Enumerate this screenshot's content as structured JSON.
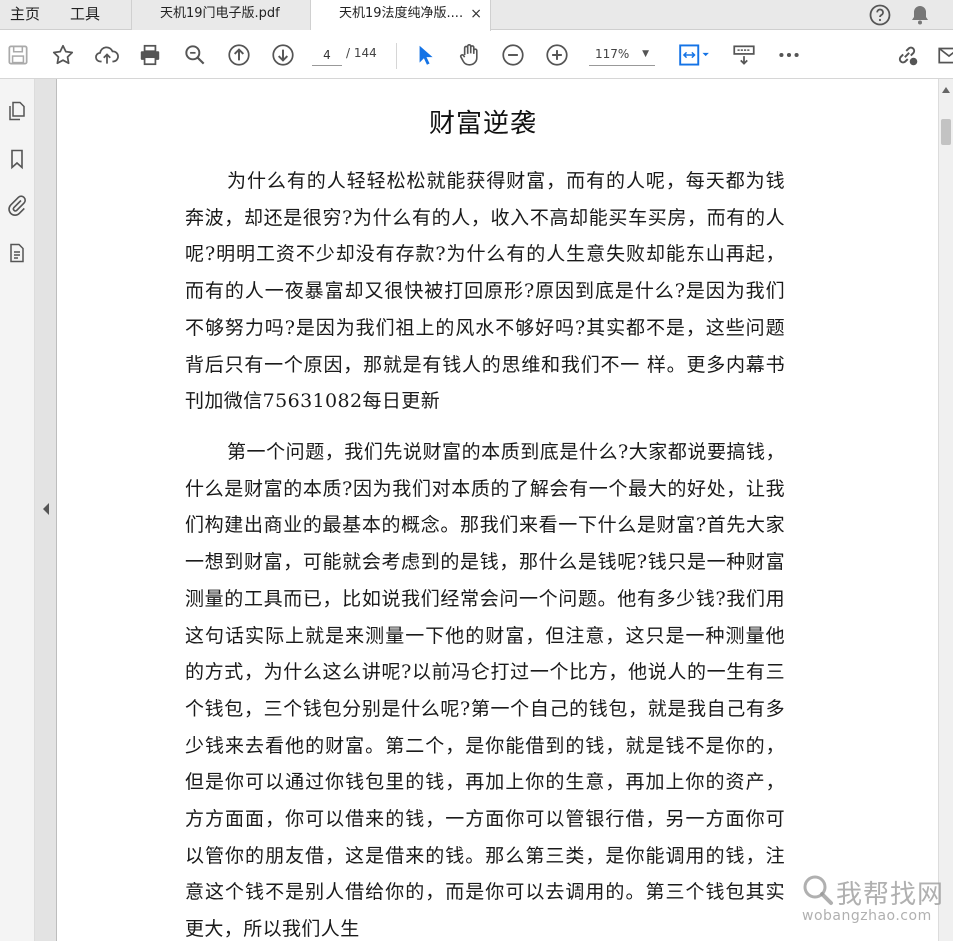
{
  "tabs": {
    "home": "主页",
    "tools": "工具",
    "documents": [
      {
        "label": "天机19门电子版.pdf",
        "active": false
      },
      {
        "label": "天机19法度纯净版....",
        "active": true
      }
    ],
    "close_glyph": "×"
  },
  "toolbar": {
    "page_current": "4",
    "page_total": "/ 144",
    "zoom": "117%",
    "zoom_caret": "▼",
    "icons": [
      "save-icon",
      "bookmark-star-icon",
      "upload-cloud-icon",
      "print-icon",
      "zoom-search-icon",
      "page-up-icon",
      "page-down-icon",
      "select-cursor-icon",
      "hand-pan-icon",
      "zoom-out-icon",
      "zoom-in-icon",
      "fit-page-icon",
      "read-mode-icon",
      "more-icon",
      "share-link-icon",
      "mail-icon"
    ]
  },
  "left_rail": {
    "icons": [
      "page-thumbnails-icon",
      "bookmarks-icon",
      "attachments-icon",
      "document-properties-icon"
    ]
  },
  "document": {
    "title": "财富逆袭",
    "paragraphs": [
      "为什么有的人轻轻松松就能获得财富，而有的人呢，每天都为钱奔波，却还是很穷?为什么有的人，收入不高却能买车买房，而有的人呢?明明工资不少却没有存款?为什么有的人生意失败却能东山再起，而有的人一夜暴富却又很快被打回原形?原因到底是什么?是因为我们不够努力吗?是因为我们祖上的风水不够好吗?其实都不是，这些问题背后只有一个原因，那就是有钱人的思维和我们不一 样。更多内幕书刊加微信75631082每日更新",
      "第一个问题，我们先说财富的本质到底是什么?大家都说要搞钱，什么是财富的本质?因为我们对本质的了解会有一个最大的好处，让我们构建出商业的最基本的概念。那我们来看一下什么是财富?首先大家一想到财富，可能就会考虑到的是钱，那什么是钱呢?钱只是一种财富测量的工具而已，比如说我们经常会问一个问题。他有多少钱?我们用这句话实际上就是来测量一下他的财富，但注意，这只是一种测量他的方式，为什么这么讲呢?以前冯仑打过一个比方，他说人的一生有三个钱包，三个钱包分别是什么呢?第一个自己的钱包，就是我自己有多少钱来去看他的财富。第二个，是你能借到的钱，就是钱不是你的，但是你可以通过你钱包里的钱，再加上你的生意，再加上你的资产，方方面面，你可以借来的钱，一方面你可以管银行借，另一方面你可以管你的朋友借，这是借来的钱。那么第三类，是你能调用的钱，注意这个钱不是别人借给你的，而是你可以去调用的。第三个钱包其实更大，所以我们人生"
    ]
  },
  "watermark": {
    "main": "我帮找网",
    "sub": "wobangzhao.com"
  },
  "colors": {
    "tab_bar_bg": "#e9e9e9",
    "accent_blue": "#1473e6",
    "icon_gray": "#555555"
  }
}
